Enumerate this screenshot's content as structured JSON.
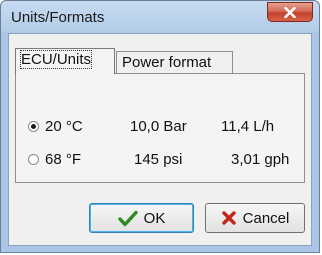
{
  "window": {
    "title": "Units/Formats"
  },
  "icons": {
    "close": "close-icon",
    "ok": "checkmark-icon",
    "cancel": "x-icon"
  },
  "tabs": [
    {
      "label": "ECU/Units",
      "active": true
    },
    {
      "label": "Power format",
      "active": false
    }
  ],
  "options": [
    {
      "selected": true,
      "temperature": "20 °C",
      "pressure": "10,0 Bar",
      "flow": "11,4 L/h"
    },
    {
      "selected": false,
      "temperature": "68 °F",
      "pressure": "145 psi",
      "flow": "3,01 gph"
    }
  ],
  "buttons": {
    "ok_label": "OK",
    "cancel_label": "Cancel"
  },
  "colors": {
    "check_green": "#2e8b1f",
    "cancel_red": "#c0261a",
    "title_bar": "#b3cde9"
  }
}
